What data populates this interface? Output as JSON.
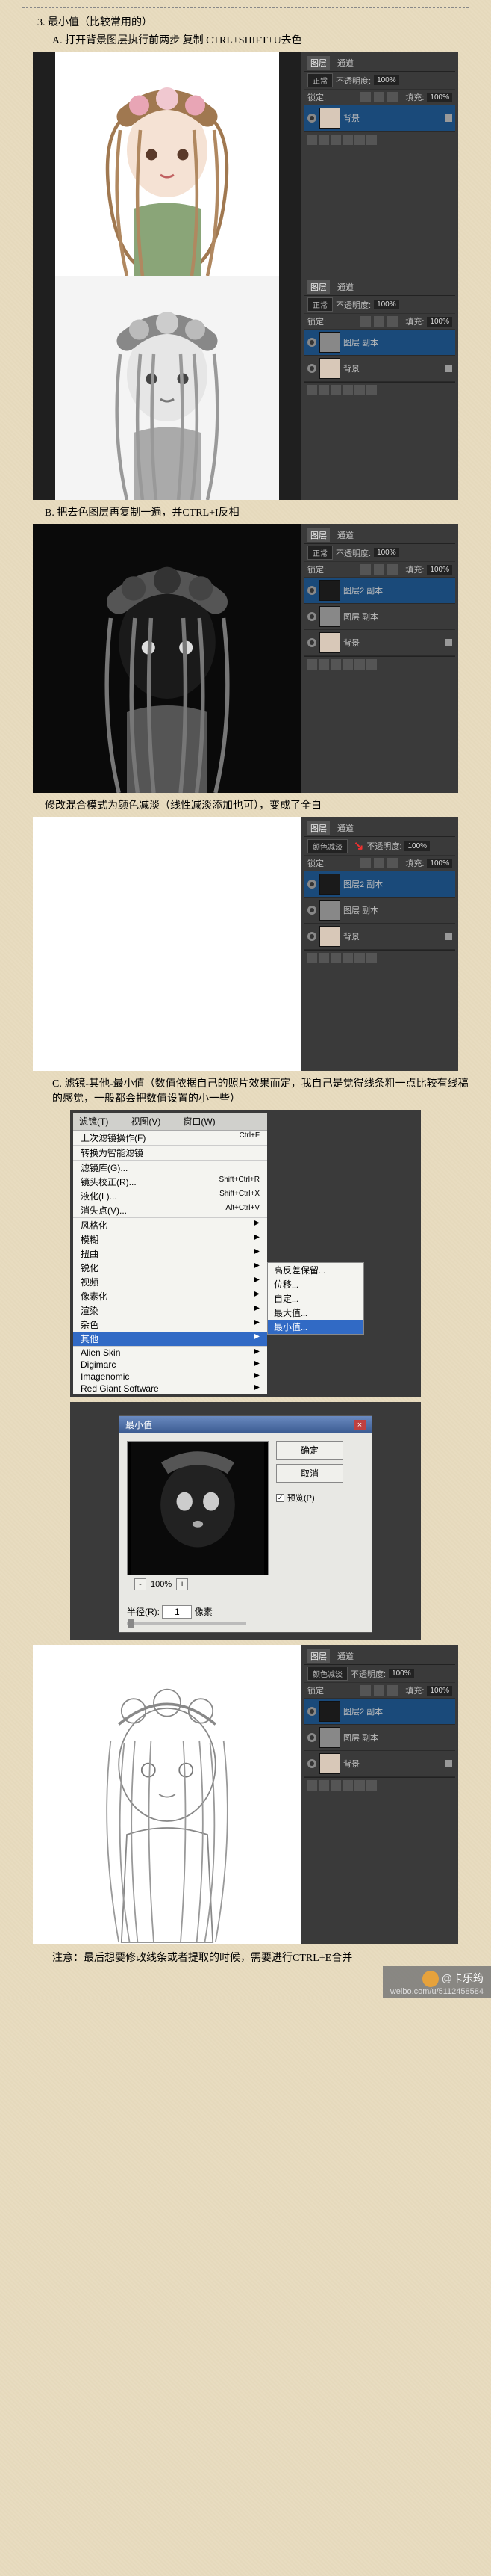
{
  "step": {
    "title": "3. 最小值（比较常用的）",
    "a": "A. 打开背景图层执行前两步 复制 CTRL+SHIFT+U去色",
    "b": "B. 把去色图层再复制一遍，并CTRL+I反相",
    "blend_note": "修改混合模式为颜色减淡（线性减淡添加也可），变成了全白",
    "c": "C. 滤镜-其他-最小值（数值依据自己的照片效果而定，我自己是觉得线条粗一点比较有线稿的感觉，一般都会把数值设置的小一些）",
    "final_note": "注意：最后想要修改线条或者提取的时候，需要进行CTRL+E合并"
  },
  "panel": {
    "tab_layers": "图层",
    "tab_channels": "通道",
    "opacity_label": "不透明度:",
    "opacity_val": "100%",
    "lock_label": "锁定:",
    "fill_label": "填充:",
    "fill_val": "100%",
    "mode_normal": "正常",
    "mode_dodge": "颜色减淡",
    "layer_bg": "背景",
    "layer_copy": "图层 副本",
    "layer_copy2": "图层2 副本"
  },
  "filter_menu": {
    "head1": "滤镜(T)",
    "head2": "视图(V)",
    "head3": "窗口(W)",
    "items": [
      {
        "l": "上次滤镜操作(F)",
        "r": "Ctrl+F"
      },
      {
        "l": "转换为智能滤镜",
        "r": ""
      },
      {
        "l": "滤镜库(G)...",
        "r": ""
      },
      {
        "l": "镜头校正(R)...",
        "r": "Shift+Ctrl+R"
      },
      {
        "l": "液化(L)...",
        "r": "Shift+Ctrl+X"
      },
      {
        "l": "消失点(V)...",
        "r": "Alt+Ctrl+V"
      },
      {
        "l": "风格化",
        "r": "▶"
      },
      {
        "l": "模糊",
        "r": "▶"
      },
      {
        "l": "扭曲",
        "r": "▶"
      },
      {
        "l": "锐化",
        "r": "▶"
      },
      {
        "l": "视频",
        "r": "▶"
      },
      {
        "l": "像素化",
        "r": "▶"
      },
      {
        "l": "渲染",
        "r": "▶"
      },
      {
        "l": "杂色",
        "r": "▶"
      },
      {
        "l": "其他",
        "r": "▶",
        "hover": true
      },
      {
        "l": "Alien Skin",
        "r": "▶"
      },
      {
        "l": "Digimarc",
        "r": "▶"
      },
      {
        "l": "Imagenomic",
        "r": "▶"
      },
      {
        "l": "Red Giant Software",
        "r": "▶"
      }
    ],
    "sub": [
      "高反差保留...",
      "位移...",
      "自定...",
      "最大值...",
      "最小值..."
    ],
    "sub_hover": "最小值..."
  },
  "dialog": {
    "title": "最小值",
    "ok": "确定",
    "cancel": "取消",
    "preview_chk": "预览(P)",
    "zoom": "100%",
    "radius_label": "半径(R):",
    "radius_val": "1",
    "radius_unit": "像素"
  },
  "watermark": {
    "at": "@",
    "name": "卡乐筠",
    "url": "weibo.com/u/5112458584"
  }
}
